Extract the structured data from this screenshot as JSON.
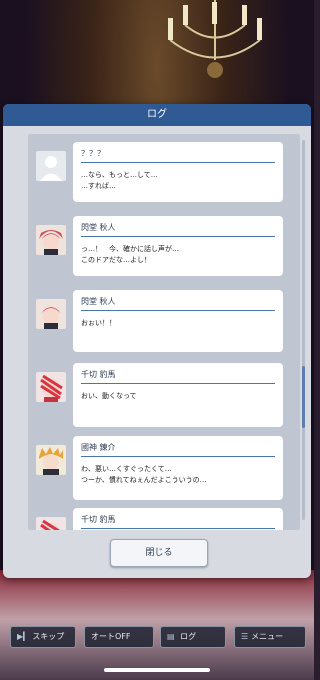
{
  "dialog": {
    "title": "ログ",
    "close_label": "閉じる"
  },
  "entries": [
    {
      "name": "？？？",
      "text": "…なら、もっと…して…\n…すれば…",
      "avatar": "unknown-silhouette"
    },
    {
      "name": "閃堂 秋人",
      "text": "っ…！　今、確かに話し声が…\nこのドアだな…よし！",
      "avatar": "akito"
    },
    {
      "name": "閃堂 秋人",
      "text": "おぉい！！",
      "avatar": "akito"
    },
    {
      "name": "千切 豹馬",
      "text": "おい、動くなって",
      "avatar": "hyoma"
    },
    {
      "name": "國神 錬介",
      "text": "わ、悪い…くすぐったくて…\nつーか、慣れてねぇんだよこういうの…",
      "avatar": "rensuke"
    },
    {
      "name": "千切 豹馬",
      "text": "",
      "avatar": "hyoma"
    }
  ],
  "bottom_bar": {
    "skip": "スキップ",
    "auto": "オートOFF",
    "log": "ログ",
    "menu": "メニュー"
  },
  "colors": {
    "header": "#2f5a94",
    "accent": "#4a76b0"
  }
}
